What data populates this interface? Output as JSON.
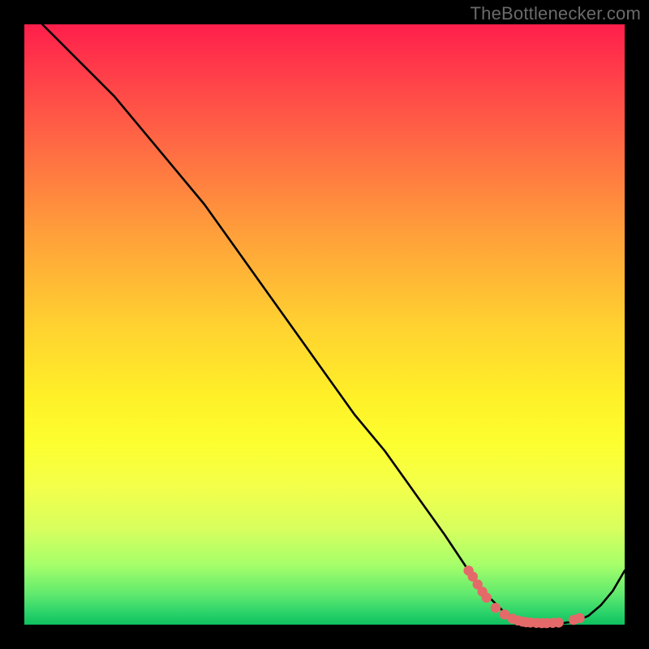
{
  "attribution": "TheBottlenecker.com",
  "chart_data": {
    "type": "line",
    "title": "",
    "xlabel": "",
    "ylabel": "",
    "xlim": [
      0,
      100
    ],
    "ylim": [
      0,
      100
    ],
    "series": [
      {
        "name": "bottleneck-curve",
        "x": [
          3,
          6,
          9,
          12,
          15,
          20,
          25,
          30,
          35,
          40,
          45,
          50,
          55,
          60,
          65,
          70,
          74,
          77,
          80,
          82,
          84,
          86,
          88,
          90,
          92,
          94,
          96,
          98,
          100
        ],
        "y": [
          100,
          97,
          94,
          91,
          88,
          82,
          76,
          70,
          63,
          56,
          49,
          42,
          35,
          29,
          22,
          15,
          9,
          5,
          2,
          1,
          0.5,
          0.3,
          0.2,
          0.3,
          0.6,
          1.5,
          3.2,
          5.6,
          9
        ]
      }
    ],
    "markers": {
      "name": "highlight-points",
      "color": "#e46a6a",
      "x": [
        74.0,
        74.7,
        75.5,
        76.3,
        77.0,
        78.5,
        80.0,
        81.3,
        82.2,
        83.0,
        83.6,
        84.3,
        85.3,
        86.2,
        87.0,
        88.0,
        89.0,
        91.5,
        92.5
      ],
      "y": [
        9.0,
        8.0,
        6.7,
        5.5,
        4.5,
        2.8,
        1.7,
        1.0,
        0.7,
        0.5,
        0.4,
        0.35,
        0.3,
        0.25,
        0.25,
        0.3,
        0.35,
        0.8,
        1.1
      ]
    },
    "gradient_stops": [
      {
        "pct": 0,
        "color": "#ff1f4b"
      },
      {
        "pct": 50,
        "color": "#ffd130"
      },
      {
        "pct": 70,
        "color": "#fcff30"
      },
      {
        "pct": 95,
        "color": "#5fe96e"
      },
      {
        "pct": 100,
        "color": "#0fbf5e"
      }
    ]
  }
}
